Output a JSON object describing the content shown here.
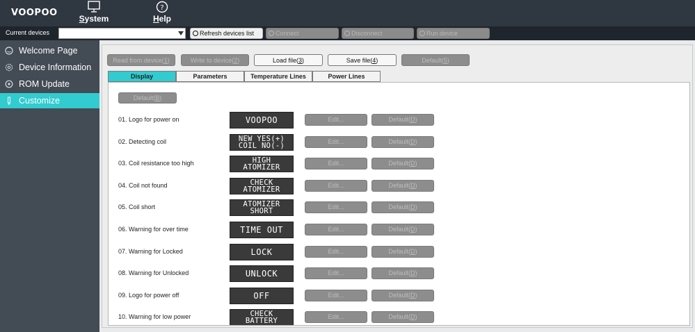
{
  "app": {
    "logo": "VOOPOO"
  },
  "topmenu": [
    {
      "label_first": "S",
      "label_rest": "ystem",
      "icon": "monitor-icon"
    },
    {
      "label_first": "H",
      "label_rest": "elp",
      "icon": "help-circle-icon"
    }
  ],
  "devices_bar": {
    "label": "Current devices",
    "selected": "",
    "buttons": [
      {
        "label": "Refresh devices list",
        "enabled": true
      },
      {
        "label": "Connect",
        "enabled": false
      },
      {
        "label": "Disconnect",
        "enabled": false
      },
      {
        "label": "Run device",
        "enabled": false
      }
    ]
  },
  "sidebar": {
    "items": [
      {
        "label": "Welcome Page",
        "icon": "smile-icon",
        "active": false
      },
      {
        "label": "Device Information",
        "icon": "gear-icon",
        "active": false
      },
      {
        "label": "ROM Update",
        "icon": "refresh-icon",
        "active": false
      },
      {
        "label": "Customize",
        "icon": "pencil-icon",
        "active": true
      }
    ]
  },
  "actions": [
    {
      "label": "Read from device",
      "key": "1",
      "enabled": false
    },
    {
      "label": "Write to device",
      "key": "2",
      "enabled": false
    },
    {
      "label": "Load file",
      "key": "3",
      "enabled": true
    },
    {
      "label": "Save file",
      "key": "4",
      "enabled": true
    },
    {
      "label": "Default",
      "key": "5",
      "enabled": false
    }
  ],
  "tabs": [
    {
      "label": "Display",
      "active": true
    },
    {
      "label": "Parameters",
      "active": false
    },
    {
      "label": "Temperature Lines",
      "active": false
    },
    {
      "label": "Power Lines",
      "active": false
    }
  ],
  "display": {
    "default_button": {
      "label": "Default",
      "key": "B"
    },
    "edit_label": "Edit...",
    "row_default": {
      "label": "Default",
      "key": "D"
    },
    "rows": [
      {
        "label": "01. Logo for power on",
        "lcd1": "VOOPOO",
        "lcd2": ""
      },
      {
        "label": "02. Detecting coil",
        "lcd1": "NEW  YES(+)",
        "lcd2": "COIL  NO(-)"
      },
      {
        "label": "03. Coil resistance too high",
        "lcd1": "HIGH",
        "lcd2": "ATOMIZER"
      },
      {
        "label": "04. Coil not found",
        "lcd1": "CHECK",
        "lcd2": "ATOMIZER"
      },
      {
        "label": "05. Coil short",
        "lcd1": "ATOMIZER",
        "lcd2": "SHORT"
      },
      {
        "label": "06. Warning for over time",
        "lcd1": "TIME OUT",
        "lcd2": ""
      },
      {
        "label": "07. Warning for Locked",
        "lcd1": "LOCK",
        "lcd2": ""
      },
      {
        "label": "08. Warning for Unlocked",
        "lcd1": "UNLOCK",
        "lcd2": ""
      },
      {
        "label": "09. Logo for power off",
        "lcd1": "OFF",
        "lcd2": ""
      },
      {
        "label": "10. Warning for low power",
        "lcd1": "CHECK",
        "lcd2": "BATTERY"
      }
    ]
  }
}
